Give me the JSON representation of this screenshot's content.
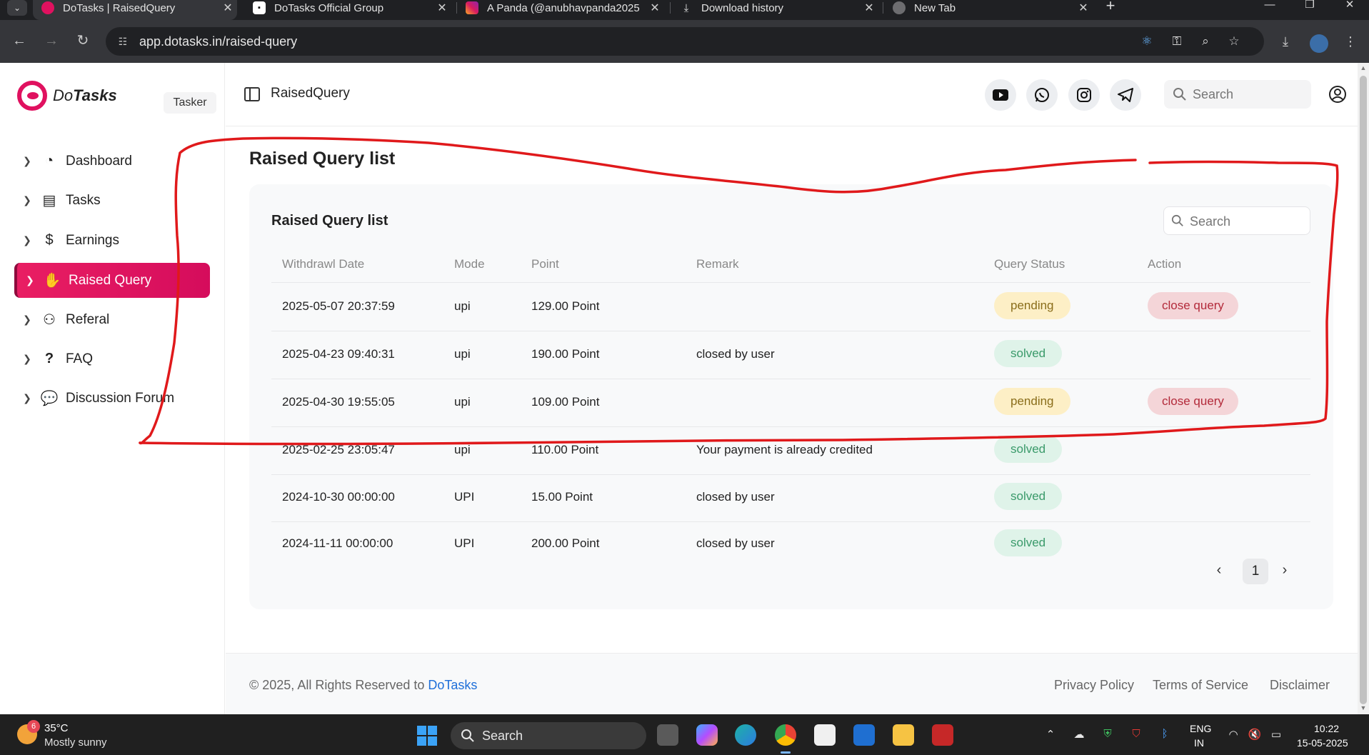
{
  "browser": {
    "tabs": [
      {
        "title": "DoTasks | RaisedQuery",
        "active": true
      },
      {
        "title": "DoTasks Official Group",
        "active": false
      },
      {
        "title": "A Panda (@anubhavpanda2025",
        "active": false
      },
      {
        "title": "Download history",
        "active": false
      },
      {
        "title": "New Tab",
        "active": false
      }
    ],
    "url": "app.dotasks.in/raised-query"
  },
  "brand": {
    "name_part1": "Do",
    "name_part2": "Tasks",
    "role": "Tasker"
  },
  "sidebar": {
    "items": [
      {
        "label": "Dashboard",
        "icon": "chart-pie-icon"
      },
      {
        "label": "Tasks",
        "icon": "list-icon"
      },
      {
        "label": "Earnings",
        "icon": "dollar-icon"
      },
      {
        "label": "Raised Query",
        "icon": "hand-icon",
        "active": true
      },
      {
        "label": "Referal",
        "icon": "referral-icon"
      },
      {
        "label": "FAQ",
        "icon": "question-icon"
      },
      {
        "label": "Discussion Forum",
        "icon": "chat-icon"
      }
    ]
  },
  "header": {
    "title": "RaisedQuery",
    "search_placeholder": "Search",
    "social": [
      "youtube-icon",
      "whatsapp-icon",
      "instagram-icon",
      "telegram-icon"
    ]
  },
  "page": {
    "title": "Raised Query list",
    "card_title": "Raised Query list",
    "search_placeholder": "Search"
  },
  "table": {
    "columns": [
      "Withdrawl Date",
      "Mode",
      "Point",
      "Remark",
      "Query Status",
      "Action"
    ],
    "rows": [
      {
        "date": "2025-05-07 20:37:59",
        "mode": "upi",
        "point": "129.00 Point",
        "remark": "",
        "status": "pending",
        "action": "close query"
      },
      {
        "date": "2025-04-23 09:40:31",
        "mode": "upi",
        "point": "190.00 Point",
        "remark": "closed by user",
        "status": "solved",
        "action": ""
      },
      {
        "date": "2025-04-30 19:55:05",
        "mode": "upi",
        "point": "109.00 Point",
        "remark": "",
        "status": "pending",
        "action": "close query"
      },
      {
        "date": "2025-02-25 23:05:47",
        "mode": "upi",
        "point": "110.00 Point",
        "remark": "Your payment is already credited",
        "status": "solved",
        "action": ""
      },
      {
        "date": "2024-10-30 00:00:00",
        "mode": "UPI",
        "point": "15.00 Point",
        "remark": "closed by user",
        "status": "solved",
        "action": ""
      },
      {
        "date": "2024-11-11 00:00:00",
        "mode": "UPI",
        "point": "200.00 Point",
        "remark": "closed by user",
        "status": "solved",
        "action": ""
      }
    ]
  },
  "pagination": {
    "current_page": "1"
  },
  "footer": {
    "copyright_prefix": "© 2025, All Rights Reserved to",
    "copyright_brand": "DoTasks",
    "links": [
      "Privacy Policy",
      "Terms of Service",
      "Disclaimer"
    ]
  },
  "annotation": {
    "color": "#e0191b",
    "shape": "hand-drawn-outline"
  },
  "taskbar": {
    "weather_badge": "6",
    "temperature": "35°C",
    "weather": "Mostly sunny",
    "search": "Search",
    "lang_line1": "ENG",
    "lang_line2": "IN",
    "time": "10:22",
    "date": "15-05-2025"
  },
  "colors": {
    "accent": "#e0115f",
    "pending_bg": "#fdefc6",
    "solved_bg": "#dff3e9",
    "close_bg": "#f4d5d8",
    "link": "#1e6fd9"
  }
}
